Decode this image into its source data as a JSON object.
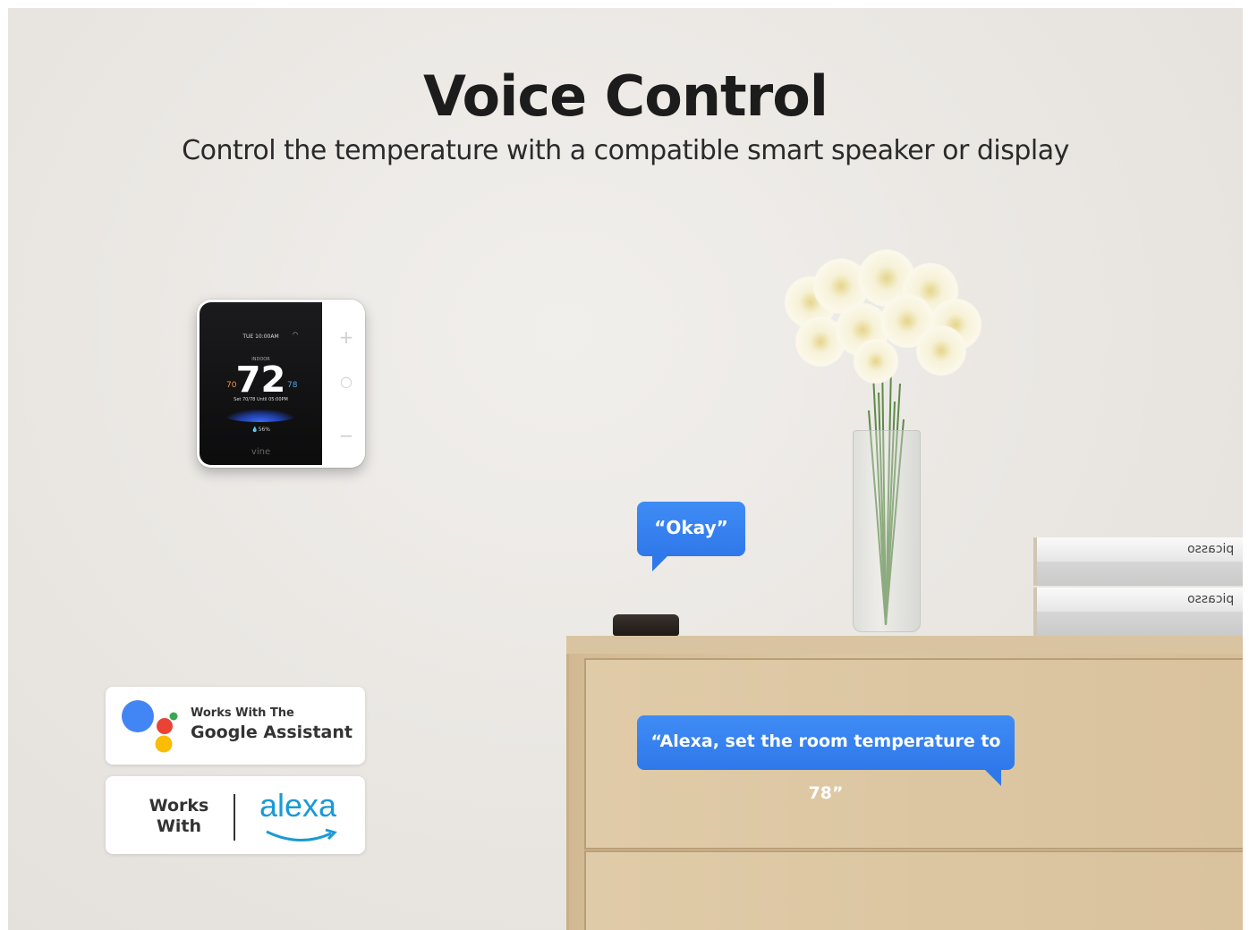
{
  "header": {
    "title": "Voice Control",
    "subtitle": "Control the temperature with a compatible smart speaker or display"
  },
  "thermostat": {
    "time": "TUE 10:00AM",
    "mode_label": "INDOOR",
    "temperature": "72",
    "low": "70",
    "high": "78",
    "schedule": "Set 70/78 Until 05:00PM",
    "humidity": "56%",
    "brand": "vine",
    "plus_button": "+",
    "mode_button": "○",
    "minus_button": "−"
  },
  "badges": {
    "google": {
      "line1": "Works With The",
      "line2": "Google Assistant",
      "colors": [
        "#4285F4",
        "#EA4335",
        "#FBBC05",
        "#34A853"
      ]
    },
    "alexa": {
      "works_line1": "Works",
      "works_line2": "With",
      "logo_word": "alexa",
      "logo_color": "#1a9ad6"
    }
  },
  "bubbles": {
    "okay": "“Okay”",
    "alexa": "“Alexa, set the room temperature to 78”"
  },
  "books": {
    "label": "picasso"
  }
}
